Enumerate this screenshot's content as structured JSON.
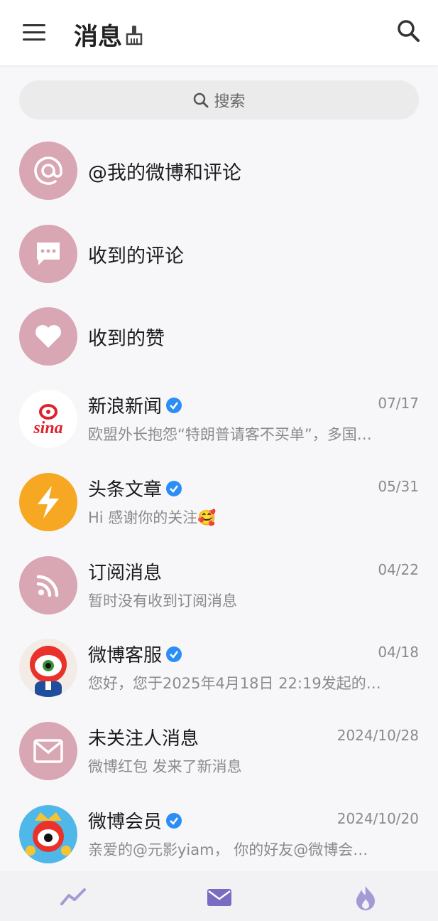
{
  "header": {
    "title": "消息",
    "menu_icon": "hamburger-menu-icon",
    "clean_icon": "broom-icon",
    "search_icon": "search-icon"
  },
  "search": {
    "placeholder": "搜索"
  },
  "colors": {
    "accent_pink": "#d9a6b3",
    "orange": "#f7a823",
    "verified_blue": "#2c8ef5",
    "nav_purple": "#7a6cc0",
    "gray_text": "#8a8a8a"
  },
  "shortcuts": [
    {
      "label": "@我的微博和评论",
      "icon": "at-icon"
    },
    {
      "label": "收到的评论",
      "icon": "comment-icon"
    },
    {
      "label": "收到的赞",
      "icon": "heart-icon"
    }
  ],
  "conversations": [
    {
      "name": "新浪新闻",
      "verified": true,
      "date": "07/17",
      "preview": "欧盟外长抱怨“特朗普请客不买单”，多国…",
      "avatar": "sina-logo"
    },
    {
      "name": "头条文章",
      "verified": true,
      "date": "05/31",
      "preview": "Hi 感谢你的关注🥰",
      "avatar": "lightning-icon"
    },
    {
      "name": "订阅消息",
      "verified": false,
      "date": "04/22",
      "preview": "暂时没有收到订阅消息",
      "avatar": "rss-icon"
    },
    {
      "name": "微博客服",
      "verified": true,
      "date": "04/18",
      "preview": "您好，您于2025年4月18日 22:19发起的…",
      "avatar": "weibo-mascot-avatar"
    },
    {
      "name": "未关注人消息",
      "verified": false,
      "date": "2024/10/28",
      "preview": "微博红包 发来了新消息",
      "avatar": "mail-icon"
    },
    {
      "name": "微博会员",
      "verified": true,
      "date": "2024/10/20",
      "preview": "亲爱的@元影yiam， 你的好友@微博会…",
      "avatar": "weibo-vip-mascot-avatar"
    }
  ],
  "bottom_nav": [
    {
      "icon": "trend-icon",
      "active": false
    },
    {
      "icon": "message-icon",
      "active": true
    },
    {
      "icon": "hot-flame-icon",
      "active": false
    }
  ]
}
